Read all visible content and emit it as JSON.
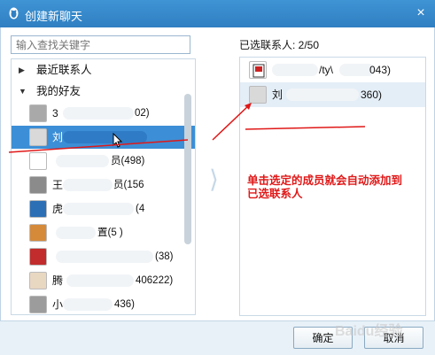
{
  "window": {
    "title": "创建新聊天",
    "close_glyph": "×",
    "qq_icon": "qq-penguin-icon",
    "accent": "#3a8bcc"
  },
  "search": {
    "placeholder": "输入查找关键字"
  },
  "contact_tree": {
    "groups": [
      {
        "label": "最近联系人",
        "expanded": false,
        "arrow": "▶"
      },
      {
        "label": "我的好友",
        "expanded": true,
        "arrow": "▼"
      }
    ],
    "contacts": [
      {
        "name": "3",
        "number": "02)",
        "selected": false,
        "avatar_color": "#a9a9a9"
      },
      {
        "name": "刘",
        "number": "",
        "selected": true,
        "avatar_color": "#d9d9d9"
      },
      {
        "name": "",
        "number": "员(498)",
        "selected": false,
        "avatar_color": "#ffffff"
      },
      {
        "name": "王",
        "number": "员(156",
        "selected": false,
        "avatar_color": "#8b8b8b"
      },
      {
        "name": "虎",
        "number": "(4",
        "selected": false,
        "avatar_color": "#2c6fb5"
      },
      {
        "name": "",
        "number": "置(5 )",
        "selected": false,
        "avatar_color": "#d58a3a"
      },
      {
        "name": "",
        "number": "(38)",
        "selected": false,
        "avatar_color": "#c22c2c"
      },
      {
        "name": "腾",
        "number": "406222)",
        "selected": false,
        "avatar_color": "#e8d7c1"
      },
      {
        "name": "小",
        "number": "436)",
        "selected": false,
        "avatar_color": "#9c9c9c"
      }
    ]
  },
  "selected_panel": {
    "label": "已选联系人: 2/50",
    "items": [
      {
        "name": "",
        "suffix": "/ty\\",
        "number": "043)",
        "highlighted": false
      },
      {
        "name": "刘",
        "suffix": "",
        "number": "360)",
        "highlighted": true
      }
    ]
  },
  "annotation": {
    "text": "单击选定的成员就会自动添加到已选联系人",
    "color": "#e01818"
  },
  "footer": {
    "ok_label": "确定",
    "cancel_label": "取消"
  },
  "watermark": {
    "text": "Baidu经验"
  }
}
